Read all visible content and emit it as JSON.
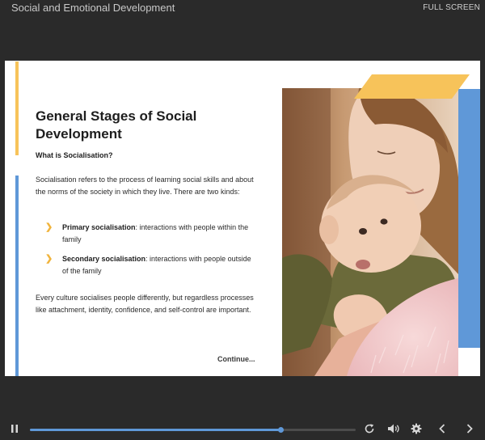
{
  "app": {
    "title": "Social and Emotional Development",
    "fullscreen_label": "FULL SCREEN"
  },
  "slide": {
    "title": "General Stages of Social Development",
    "subheading": "What is Socialisation?",
    "intro": "Socialisation refers to the process of learning social skills and about the norms of the society in which they live. There are two kinds:",
    "bullets": [
      {
        "term": "Primary socialisation",
        "desc": ": interactions with people within the family"
      },
      {
        "term": "Secondary socialisation",
        "desc": ": interactions with people outside of the family"
      }
    ],
    "closing": "Every culture socialises people differently, but regardless processes like attachment, identity, confidence, and self-control are important.",
    "continue_label": "Continue...",
    "image_icon": "mother-holding-baby-photo"
  },
  "player": {
    "progress": 0.77,
    "icons": [
      "pause-icon",
      "replay-icon",
      "volume-icon",
      "gear-icon",
      "chevron-left-icon",
      "chevron-right-icon"
    ]
  },
  "colors": {
    "background": "#2a2a2a",
    "accent_blue": "#5f98d8",
    "accent_yellow": "#f7c35a"
  }
}
